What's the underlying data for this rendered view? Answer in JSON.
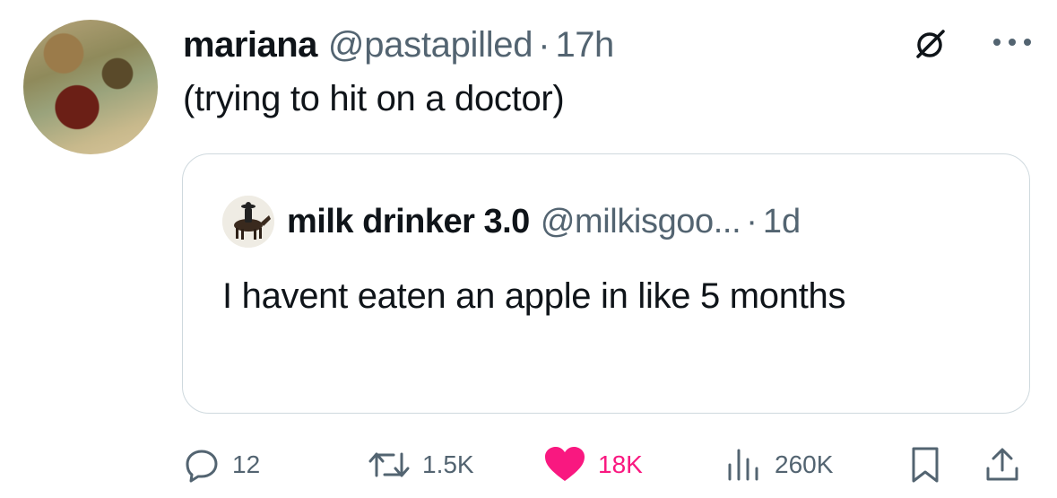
{
  "tweet": {
    "author_name": "mariana",
    "author_handle": "@pastapilled",
    "separator": "·",
    "time": "17h",
    "text": "(trying to hit on a doctor)"
  },
  "quoted_tweet": {
    "author_name": "milk drinker 3.0",
    "author_handle": "@milkisgoo...",
    "separator": "·",
    "time": "1d",
    "text": "I havent eaten an apple in like 5 months"
  },
  "actions": {
    "replies": "12",
    "reposts": "1.5K",
    "likes": "18K",
    "views": "260K"
  },
  "colors": {
    "text": "#0f1419",
    "secondary": "#536471",
    "like": "#f91880",
    "border": "#cfd9de"
  },
  "icons": [
    "grok-icon",
    "more-icon",
    "reply-icon",
    "repost-icon",
    "heart-icon",
    "views-icon",
    "bookmark-icon",
    "share-icon"
  ]
}
